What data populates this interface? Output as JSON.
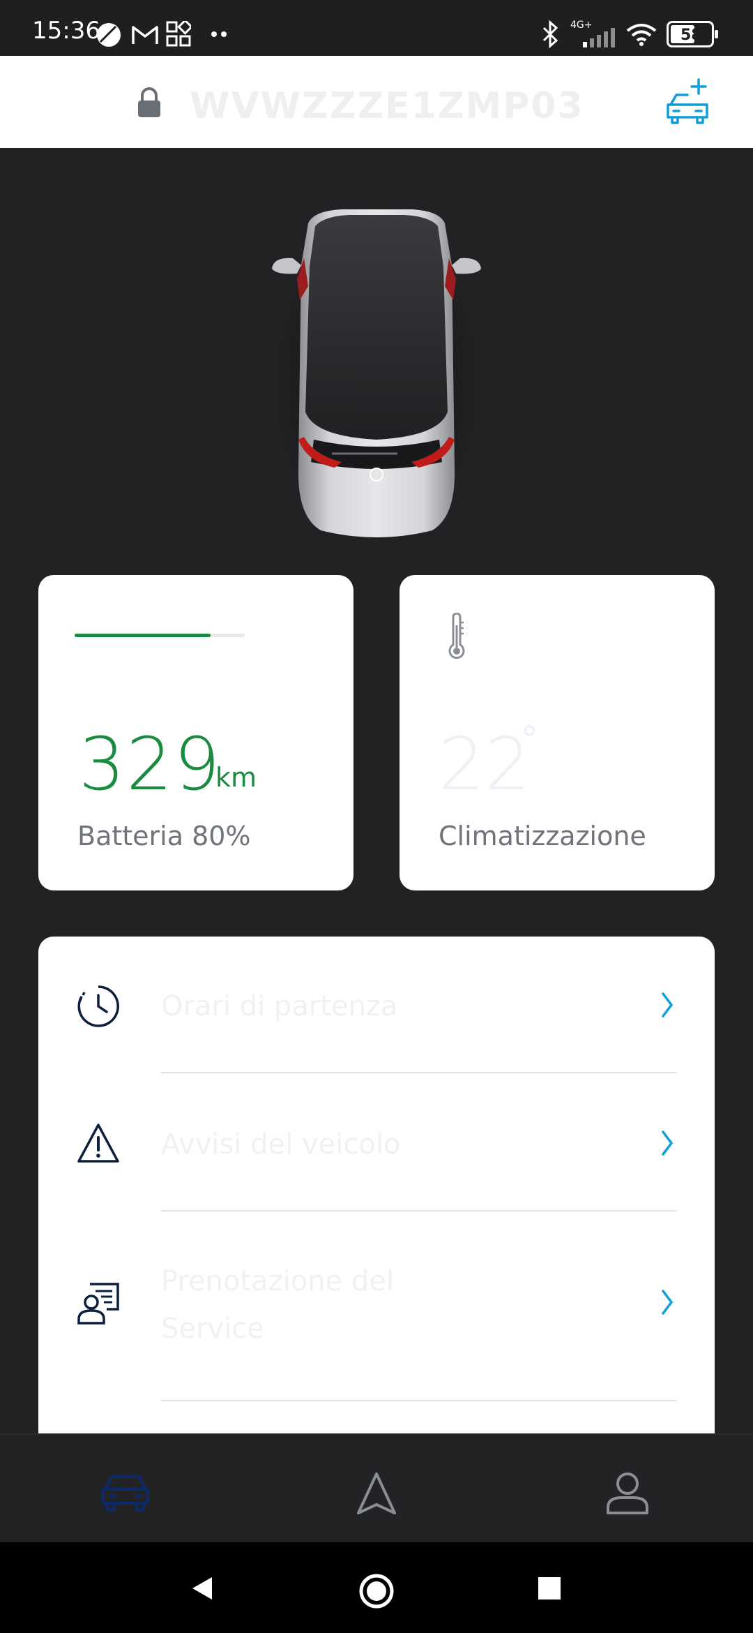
{
  "status_bar": {
    "time": "15:36",
    "network": "4G+",
    "battery": "58",
    "icons": [
      "clock-app-icon",
      "gmail-icon",
      "apps-icon",
      "more-dots-icon",
      "bluetooth-icon",
      "signal-icon",
      "wifi-icon",
      "battery-icon"
    ]
  },
  "header": {
    "vehicle_id": "WVWZZZE1ZMP03",
    "lock_icon": "lock-icon",
    "add_vehicle_icon": "add-car-icon",
    "accent_color": "#0f9fd8"
  },
  "battery_card": {
    "range_value": "329",
    "range_unit": "km",
    "label": "Batteria 80%",
    "charge_level": 0.8,
    "accent_color": "#1a8c3f"
  },
  "climate_card": {
    "temperature": "22",
    "degree_symbol": "°",
    "label": "Climatizzazione"
  },
  "menu": {
    "items": [
      {
        "label": "Orari di partenza",
        "icon": "clock-icon"
      },
      {
        "label": "Avvisi del veicolo",
        "icon": "warning-icon"
      },
      {
        "label": "Prenotazione del",
        "label2": "Service",
        "icon": "service-booking-icon"
      }
    ]
  },
  "bottom_nav": {
    "items": [
      {
        "name": "car-tab",
        "active": true
      },
      {
        "name": "navigation-tab",
        "active": false
      },
      {
        "name": "profile-tab",
        "active": false
      }
    ]
  },
  "system_nav": [
    "back-icon",
    "home-icon",
    "recents-icon"
  ]
}
